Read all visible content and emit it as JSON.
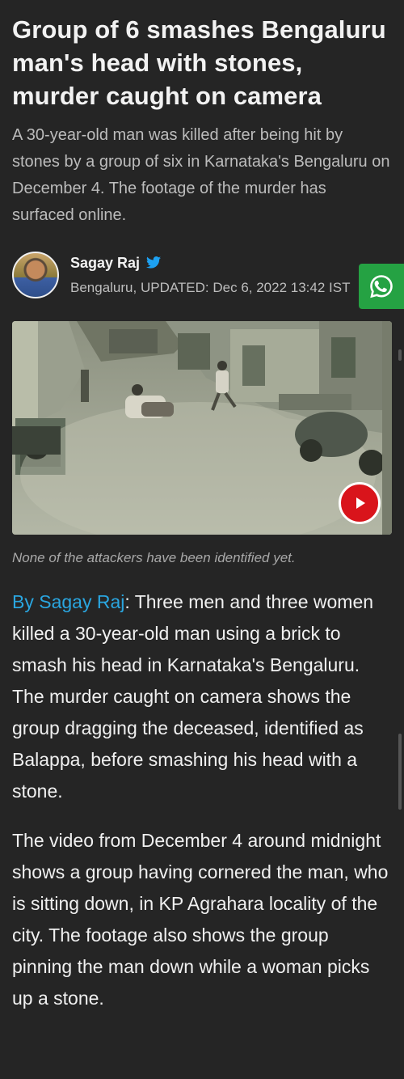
{
  "article": {
    "headline": "Group of 6 smashes Bengaluru man's head with stones, murder caught on camera",
    "summary": "A 30-year-old man was killed after being hit by stones by a group of six in Karnataka's Bengaluru on December 4. The footage of the murder has surfaced online.",
    "author": {
      "name": "Sagay Raj",
      "dateline": "Bengaluru, UPDATED: Dec 6, 2022 13:42 IST"
    },
    "video": {
      "caption": "None of the attackers have been identified yet."
    },
    "body": {
      "byline": "By Sagay Raj",
      "para1_rest": ": Three men and three women killed a 30-year-old man using a brick to smash his head in Karnataka's Bengaluru. The murder caught on camera shows the group dragging the deceased, identified as Balappa, before smashing his head with a stone.",
      "para2": "The video from December 4 around midnight shows a group having cornered the man, who is sitting down, in KP Agrahara locality of the city. The footage also shows the group pinning the man down while a woman picks up a stone."
    }
  },
  "icons": {
    "share": "whatsapp-icon",
    "verified": "twitter-icon",
    "play": "play-icon"
  },
  "colors": {
    "background": "#252525",
    "link": "#2aa6e0",
    "whatsapp": "#25a243",
    "play": "#d9141b"
  }
}
